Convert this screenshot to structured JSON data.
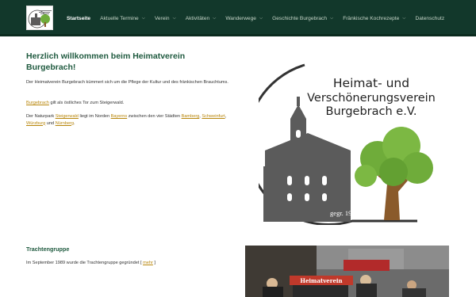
{
  "logo_small": {
    "caption": "Heimat- und Verschönerungsverein Burgebrach e.V."
  },
  "nav": {
    "items": [
      {
        "label": "Startseite",
        "active": true,
        "has_dropdown": false
      },
      {
        "label": "Aktuelle Termine",
        "active": false,
        "has_dropdown": true
      },
      {
        "label": "Verein",
        "active": false,
        "has_dropdown": true
      },
      {
        "label": "Aktivitäten",
        "active": false,
        "has_dropdown": true
      },
      {
        "label": "Wanderwege",
        "active": false,
        "has_dropdown": true
      },
      {
        "label": "Geschichte Burgebrach",
        "active": false,
        "has_dropdown": true
      },
      {
        "label": "Fränkische Kochrezepte",
        "active": false,
        "has_dropdown": true
      },
      {
        "label": "Datenschutz",
        "active": false,
        "has_dropdown": false
      }
    ],
    "dropdown_glyph": "⌵"
  },
  "welcome": {
    "title": "Herzlich willkommen beim Heimatverein Burgebrach!",
    "intro": "Der Heimatverein Burgebrach  kümmert sich um die Pflege der Kultur und des fränkischen Brauchtums.",
    "gate_link": "Burgebrach",
    "gate_text": " gilt als östliches Tor zum Steigerwald.",
    "park": {
      "prefix": "Der Naturpark ",
      "steigerwald": "Steigerwald",
      "mid1": " liegt im Norden ",
      "bayern": "Bayerns",
      "mid2": " zwischen den vier Städten ",
      "bamberg": "Bamberg",
      "comma1": ", ",
      "schweinfurt": "Schweinfurt",
      "comma2": ", ",
      "wuerzburg": "Würzburg",
      "und": " und ",
      "nuernberg": "Nürnberg",
      "end": "."
    }
  },
  "logo_large": {
    "line1": "Heimat- und",
    "line2": "Verschönerungsverein",
    "line3": "Burgebrach e.V.",
    "founded": "gegr. 1950",
    "colors": {
      "building": "#5b5b5b",
      "tree": "#6fac3a",
      "trunk": "#8a5a2b",
      "ring": "#333333"
    }
  },
  "tracht": {
    "title": "Trachtengruppe",
    "text": "Im September 1989 wurde die Trachtengruppe gegründet [ ",
    "more": "mehr",
    "close": " ]",
    "photo_banner": "Heimatverein"
  },
  "colors": {
    "header_bg": "#12382b",
    "heading": "#1f5a3f",
    "link": "#b8860b"
  }
}
